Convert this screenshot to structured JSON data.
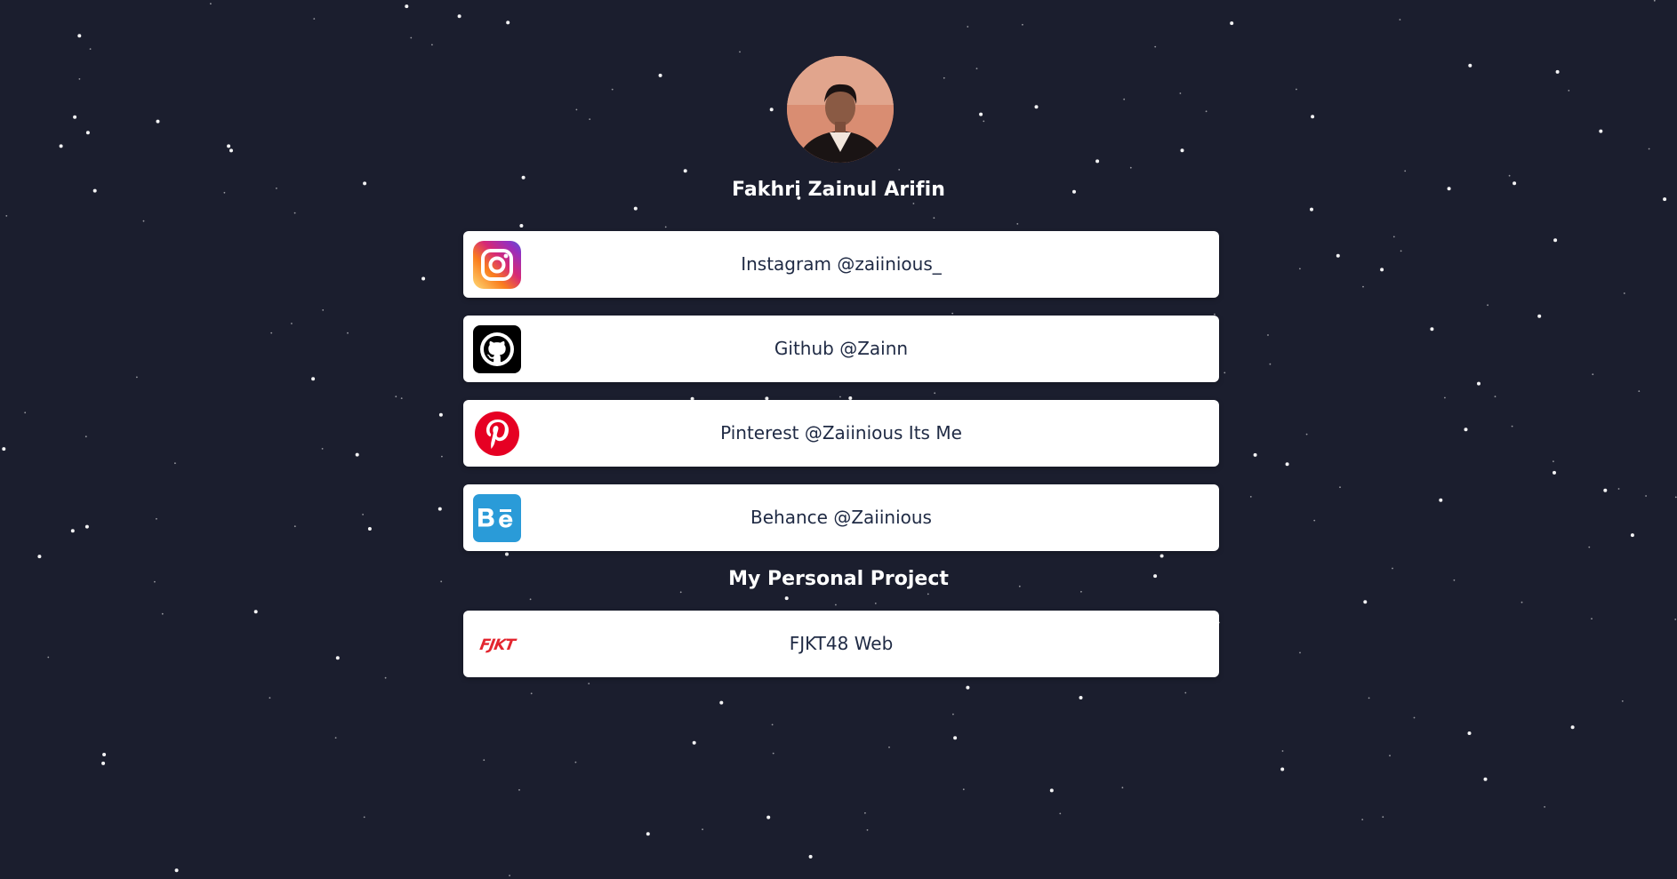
{
  "profile": {
    "name": "Fakhri Zainul Arifin",
    "avatar_icon": "profile-photo"
  },
  "links": [
    {
      "label": "Instagram @zaiinious_",
      "icon": "instagram-icon"
    },
    {
      "label": "Github @Zainn",
      "icon": "github-icon"
    },
    {
      "label": "Pinterest @Zaiinious Its Me",
      "icon": "pinterest-icon"
    },
    {
      "label": "Behance @Zaiinious",
      "icon": "behance-icon"
    }
  ],
  "projects": {
    "title": "My Personal Project",
    "items": [
      {
        "label": "FJKT48 Web",
        "icon": "fjkt48-logo-icon",
        "logo_text": "FJKT"
      }
    ]
  },
  "colors": {
    "background": "#1b1e2e",
    "card": "#ffffff",
    "card_text": "#1f2a44",
    "heading_text": "#ffffff",
    "instagram_start": "#feda75",
    "instagram_end": "#962fbf",
    "pinterest": "#e60023",
    "behance": "#1769ff",
    "fjkt48": "#e3262f"
  }
}
